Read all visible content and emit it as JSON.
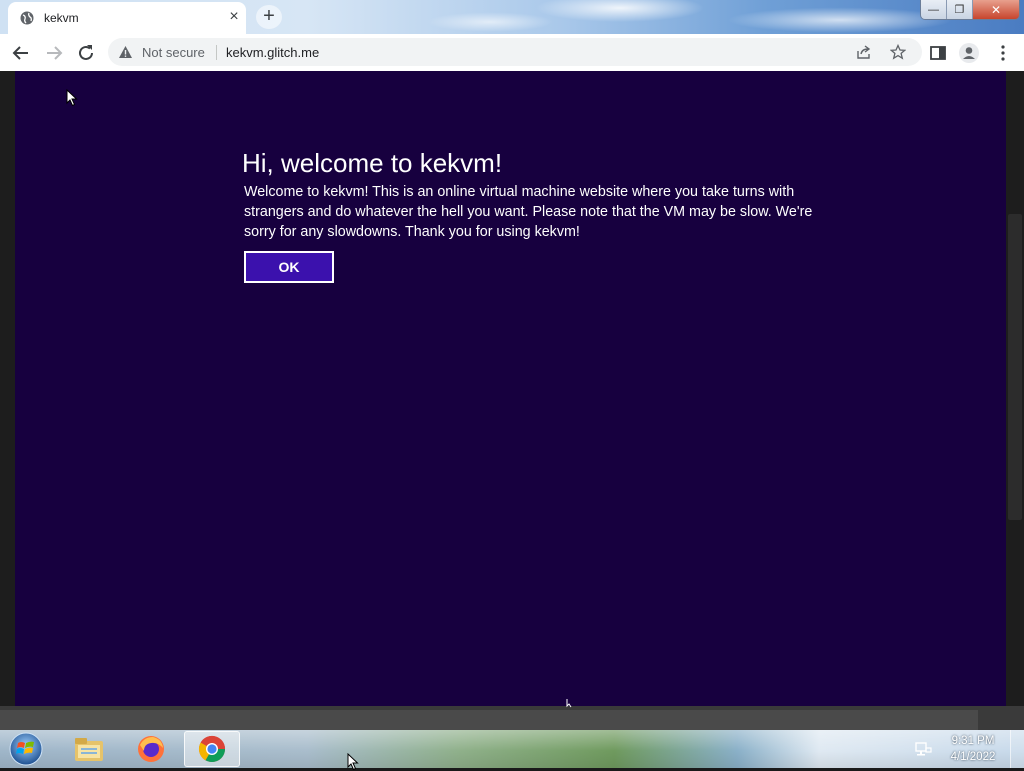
{
  "browser": {
    "tab": {
      "title": "kekvm",
      "close_glyph": "×"
    },
    "new_tab_glyph": "+",
    "window_controls": {
      "minimize": "—",
      "maximize": "❐",
      "close": "✕"
    },
    "address_bar": {
      "security_label": "Not secure",
      "url": "kekvm.glitch.me"
    }
  },
  "page": {
    "heading": "Hi, welcome to kekvm!",
    "body": "Welcome to kekvm! This is an online virtual machine website where you take turns with strangers and do whatever the hell you want. Please note that the VM may be slow. We're sorry for any slowdowns. Thank you for using kekvm!",
    "ok_label": "OK",
    "colors": {
      "background": "#17003f",
      "button": "#3b11ad",
      "text": "#ffffff"
    }
  },
  "taskbar": {
    "items": [
      {
        "name": "start-orb-icon"
      },
      {
        "name": "file-explorer-icon"
      },
      {
        "name": "firefox-icon"
      },
      {
        "name": "chrome-icon",
        "active": true
      }
    ],
    "clock": {
      "time": "9:31 PM",
      "date": "4/1/2022"
    }
  }
}
